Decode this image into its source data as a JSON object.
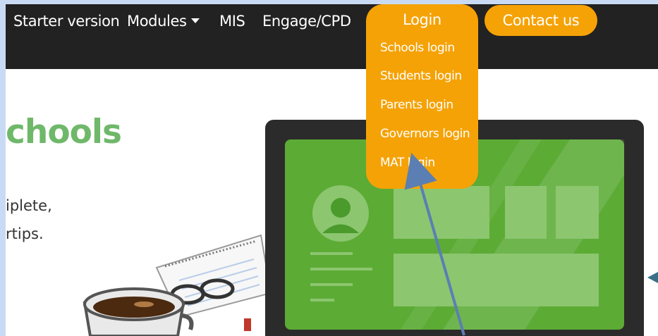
{
  "navbar": {
    "items": [
      {
        "label": "Starter version"
      },
      {
        "label": "Modules"
      },
      {
        "label": "MIS"
      },
      {
        "label": "Engage/CPD"
      }
    ],
    "login_label": "Login",
    "contact_label": "Contact us"
  },
  "login_menu": {
    "items": [
      {
        "label": "Schools login"
      },
      {
        "label": "Students login"
      },
      {
        "label": "Parents login"
      },
      {
        "label": "Governors login"
      },
      {
        "label": "MAT login"
      }
    ]
  },
  "hero": {
    "heading": "chools",
    "line1": "iplete,",
    "line2": "rtips."
  },
  "colors": {
    "accent": "#f5a206",
    "navbar": "#222222",
    "heading": "#6fb86a",
    "screen_green": "#5cab35",
    "arrow": "#5b7fb2"
  },
  "icons": [
    "caret-down-icon",
    "user-avatar-icon",
    "coffee-cup",
    "notebook",
    "glasses",
    "laptop"
  ]
}
